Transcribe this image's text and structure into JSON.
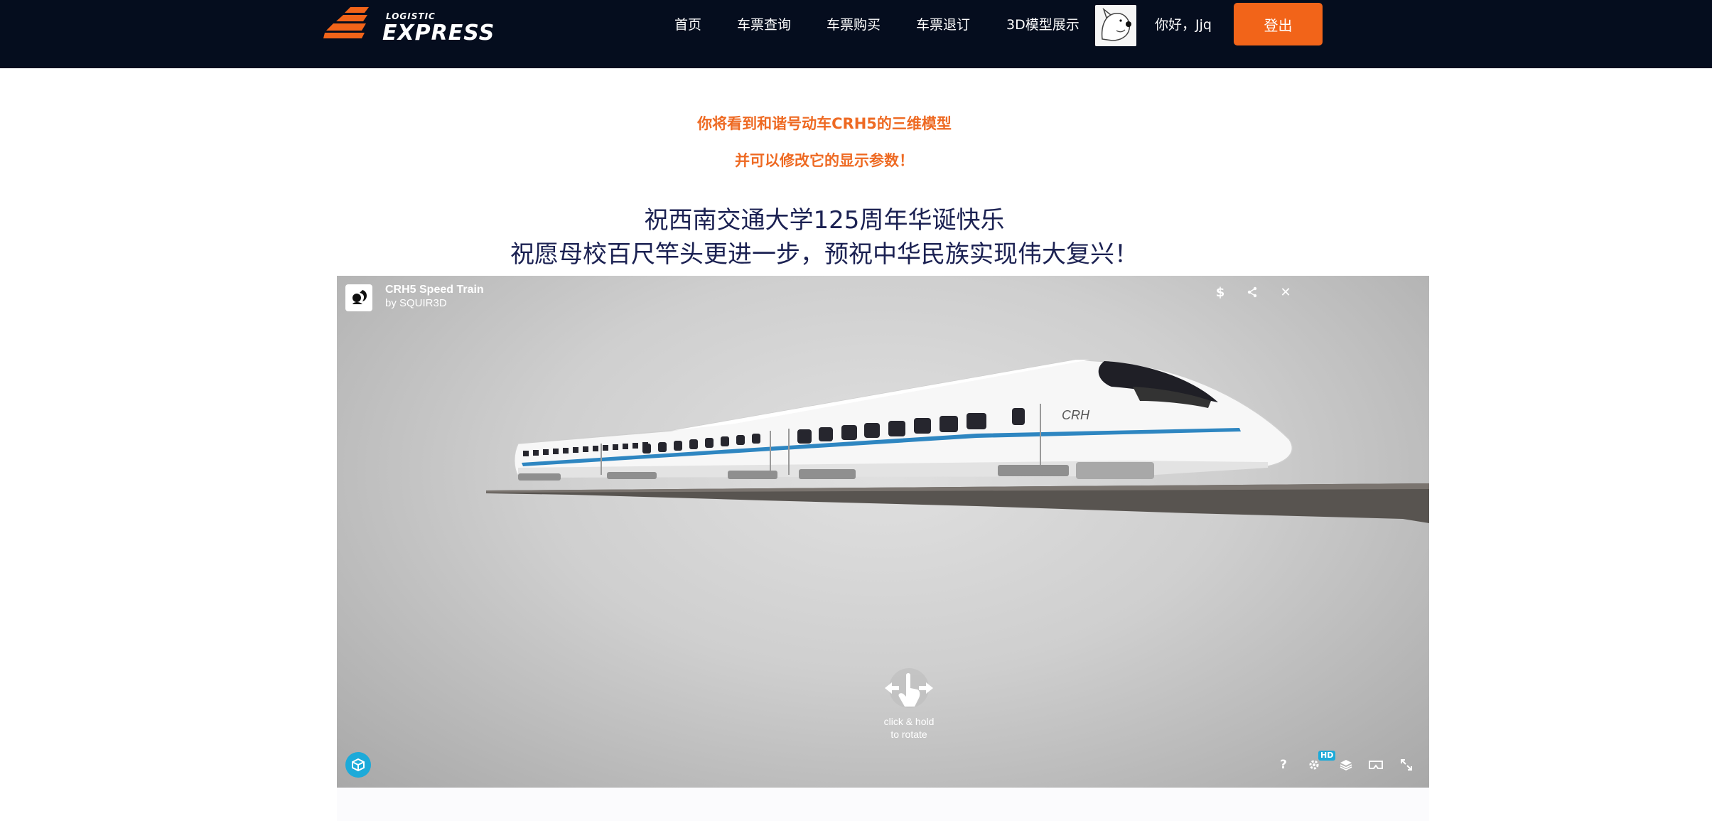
{
  "header": {
    "logo": {
      "small": "LOGISTIC",
      "big": "EXPRESS"
    },
    "nav": [
      "首页",
      "车票查询",
      "车票购买",
      "车票退订",
      "3D模型展示"
    ],
    "greeting": "你好，Jjq",
    "logout_label": "登出",
    "colors": {
      "background": "#050d1e",
      "accent": "#f26419"
    }
  },
  "intro": {
    "line1": "你将看到和谐号动车CRH5的三维模型",
    "line2": "并可以修改它的显示参数！",
    "color": "#ee6a23"
  },
  "headline": {
    "line1": "祝西南交通大学125周年华诞快乐",
    "line2": "祝愿母校百尺竿头更进一步，预祝中华民族实现伟大复兴！"
  },
  "viewer": {
    "title": "CRH5 Speed Train",
    "author": "by SQUIR3D",
    "train_label": "CRH",
    "top_icons": [
      "dollar-icon",
      "share-icon",
      "close-icon"
    ],
    "hint_line1": "click & hold",
    "hint_line2": "to rotate",
    "help": "?",
    "hd": "HD",
    "bottom_icons": [
      "help-icon",
      "settings-icon",
      "layers-icon",
      "vr-icon",
      "fullscreen-icon"
    ],
    "colors": {
      "badge": "#1caad9",
      "stripe": "#2e86c1"
    }
  }
}
